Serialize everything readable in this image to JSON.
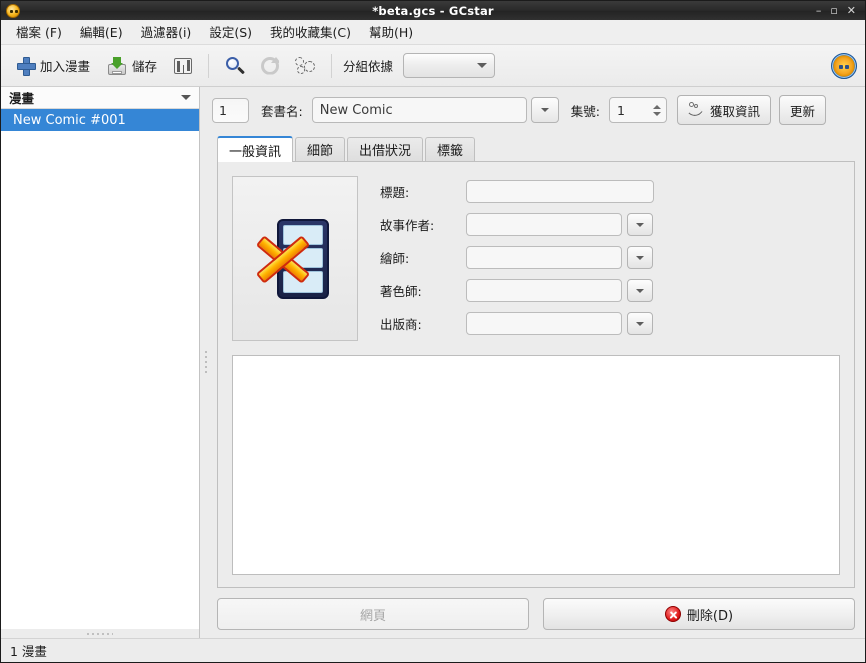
{
  "window": {
    "title": "*beta.gcs - GCstar",
    "app_icon": "gcstar-app-icon",
    "controls": {
      "minimize": "–",
      "maximize": "▫",
      "close": "✕"
    }
  },
  "menubar": {
    "items": [
      {
        "label": "檔案 (F)",
        "name": "menu-file"
      },
      {
        "label": "編輯(E)",
        "name": "menu-edit"
      },
      {
        "label": "過濾器(i)",
        "name": "menu-filter"
      },
      {
        "label": "設定(S)",
        "name": "menu-settings"
      },
      {
        "label": "我的收藏集(C)",
        "name": "menu-collection"
      },
      {
        "label": "幫助(H)",
        "name": "menu-help"
      }
    ]
  },
  "toolbar": {
    "add_label": "加入漫畫",
    "save_label": "儲存",
    "columns_icon": "columns-icon",
    "search_icon": "search-icon",
    "refresh_icon": "refresh-icon",
    "gears_icon": "gears-icon",
    "group_by_label": "分組依據",
    "group_by_value": "",
    "logo_icon": "gcstar-logo-icon"
  },
  "sidebar": {
    "header": "漫畫",
    "items": [
      {
        "label": "New Comic #001",
        "selected": true
      }
    ]
  },
  "toprow": {
    "index_value": "1",
    "series_label": "套書名:",
    "series_value": "New Comic",
    "issue_label": "集號:",
    "issue_value": "1",
    "fetch_label": "獲取資訊",
    "update_label": "更新"
  },
  "tabs": [
    {
      "label": "一般資訊",
      "active": true,
      "name": "tab-general"
    },
    {
      "label": "細節",
      "active": false,
      "name": "tab-details"
    },
    {
      "label": "出借狀況",
      "active": false,
      "name": "tab-borrow"
    },
    {
      "label": "標籤",
      "active": false,
      "name": "tab-tags"
    }
  ],
  "general": {
    "cover_placeholder_icon": "no-cover-placeholder-icon",
    "fields": [
      {
        "label": "標題:",
        "value": "",
        "name": "title-field",
        "combo": false
      },
      {
        "label": "故事作者:",
        "value": "",
        "name": "writer-field",
        "combo": true
      },
      {
        "label": "繪師:",
        "value": "",
        "name": "artist-field",
        "combo": true
      },
      {
        "label": "著色師:",
        "value": "",
        "name": "colourist-field",
        "combo": true
      },
      {
        "label": "出版商:",
        "value": "",
        "name": "publisher-field",
        "combo": true
      }
    ],
    "notes_value": ""
  },
  "bottom": {
    "webpage_label": "網頁",
    "webpage_disabled": true,
    "delete_label": "刪除(D)",
    "delete_icon": "delete-circle-icon"
  },
  "statusbar": {
    "text": "1 漫畫"
  },
  "colors": {
    "selection_blue": "#3586d6",
    "titlebar_dark": "#2b2b2b",
    "accent_tab": "#3586d6",
    "delete_red": "#e01b1b",
    "window_bg": "#ececec"
  }
}
